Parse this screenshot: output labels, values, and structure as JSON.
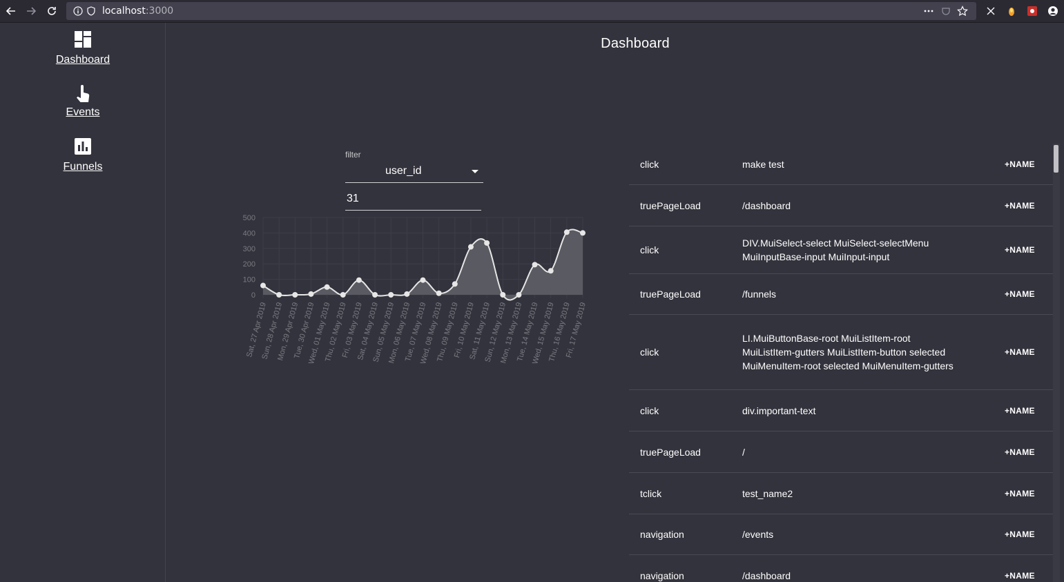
{
  "browser": {
    "url_host": "localhost",
    "url_port": ":3000"
  },
  "sidebar": {
    "items": [
      {
        "label": "Dashboard",
        "icon": "dashboard-icon"
      },
      {
        "label": "Events",
        "icon": "touch-icon"
      },
      {
        "label": "Funnels",
        "icon": "bar-chart-icon"
      }
    ]
  },
  "main": {
    "title": "Dashboard"
  },
  "filter": {
    "label": "filter",
    "selected": "user_id",
    "value": "31"
  },
  "chart_data": {
    "type": "area",
    "title": "",
    "xlabel": "",
    "ylabel": "",
    "ylim": [
      0,
      500
    ],
    "y_ticks": [
      "500",
      "400",
      "300",
      "200",
      "100",
      "0"
    ],
    "x": [
      "Sat, 27 Apr 2019",
      "Sun, 28 Apr 2019",
      "Mon, 29 Apr 2019",
      "Tue, 30 Apr 2019",
      "Wed, 01 May 2019",
      "Thu, 02 May 2019",
      "Fri, 03 May 2019",
      "Sat, 04 May 2019",
      "Sun, 05 May 2019",
      "Mon, 06 May 2019",
      "Tue, 07 May 2019",
      "Wed, 08 May 2019",
      "Thu, 09 May 2019",
      "Fri, 10 May 2019",
      "Sat, 11 May 2019",
      "Sun, 12 May 2019",
      "Mon, 13 May 2019",
      "Tue, 14 May 2019",
      "Wed, 15 May 2019",
      "Thu, 16 May 2019",
      "Fri, 17 May 2019"
    ],
    "values": [
      60,
      0,
      0,
      5,
      50,
      0,
      95,
      0,
      0,
      5,
      95,
      10,
      70,
      310,
      335,
      0,
      0,
      195,
      155,
      405,
      400
    ],
    "grid": true,
    "colors": {
      "fill": "#5a5a62",
      "line": "#e6e6e6",
      "grid": "#3e3e48",
      "tick": "#7a7a82"
    }
  },
  "events": [
    {
      "type": "click",
      "target": "make test",
      "action": "+NAME"
    },
    {
      "type": "truePageLoad",
      "target": "/dashboard",
      "action": "+NAME"
    },
    {
      "type": "click",
      "target": "DIV.MuiSelect-select MuiSelect-selectMenu MuiInputBase-input MuiInput-input",
      "action": "+NAME"
    },
    {
      "type": "truePageLoad",
      "target": "/funnels",
      "action": "+NAME"
    },
    {
      "type": "click",
      "target": "LI.MuiButtonBase-root MuiListItem-root MuiListItem-gutters MuiListItem-button selected MuiMenuItem-root selected MuiMenuItem-gutters",
      "action": "+NAME"
    },
    {
      "type": "click",
      "target": "div.important-text",
      "action": "+NAME"
    },
    {
      "type": "truePageLoad",
      "target": "/",
      "action": "+NAME"
    },
    {
      "type": "tclick",
      "target": "test_name2",
      "action": "+NAME"
    },
    {
      "type": "navigation",
      "target": "/events",
      "action": "+NAME"
    },
    {
      "type": "navigation",
      "target": "/dashboard",
      "action": "+NAME"
    }
  ]
}
